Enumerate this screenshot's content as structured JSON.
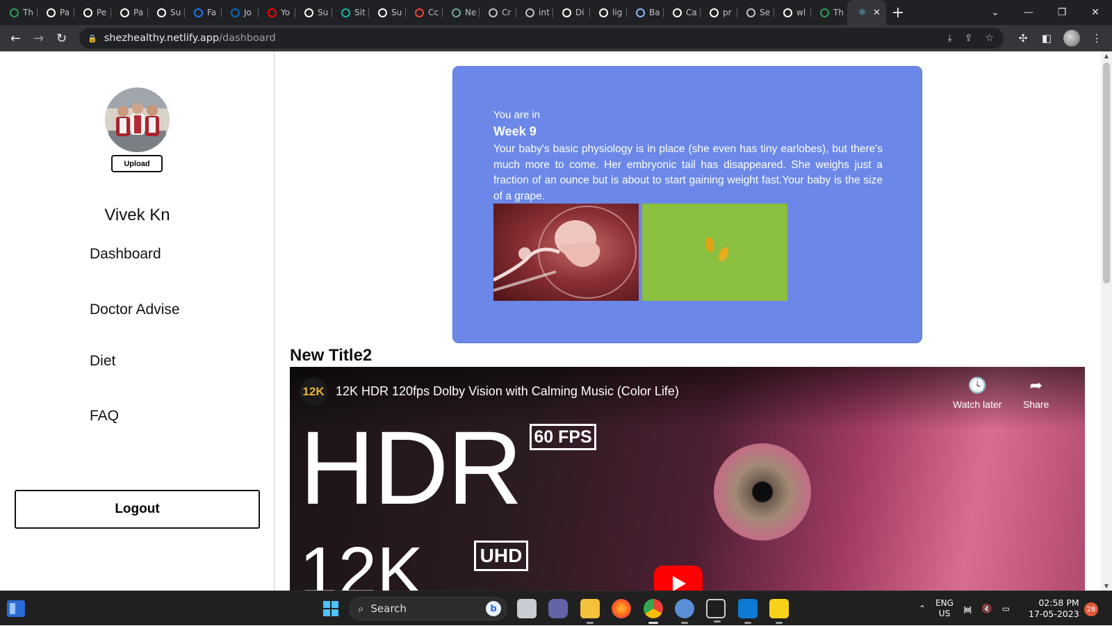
{
  "browser": {
    "tabs": [
      {
        "label": "Th",
        "icon": "wn-logo-icon",
        "color": "#2e9e5b"
      },
      {
        "label": "Pa",
        "icon": "incognito-icon",
        "color": "#ffffff"
      },
      {
        "label": "Pe",
        "icon": "incognito-icon",
        "color": "#ffffff"
      },
      {
        "label": "Pa",
        "icon": "incognito-icon",
        "color": "#ffffff"
      },
      {
        "label": "Su",
        "icon": "s-logo-icon",
        "color": "#ffffff"
      },
      {
        "label": "Fa",
        "icon": "facebook-icon",
        "color": "#1877f2"
      },
      {
        "label": "Jo",
        "icon": "linkedin-icon",
        "color": "#0a66c2"
      },
      {
        "label": "Yo",
        "icon": "youtube-icon",
        "color": "#ff0000"
      },
      {
        "label": "Su",
        "icon": "s-logo-icon",
        "color": "#ffffff"
      },
      {
        "label": "Sit",
        "icon": "diamond-icon",
        "color": "#20b2aa"
      },
      {
        "label": "Su",
        "icon": "s-logo-icon",
        "color": "#ffffff"
      },
      {
        "label": "Cc",
        "icon": "gmail-icon",
        "color": "#ea4335"
      },
      {
        "label": "Ne",
        "icon": "chatgpt-icon",
        "color": "#74aa9c"
      },
      {
        "label": "Cr",
        "icon": "square-icon",
        "color": "#bdc1c6"
      },
      {
        "label": "int",
        "icon": "square-icon",
        "color": "#bdc1c6"
      },
      {
        "label": "Di",
        "icon": "eg-icon",
        "color": "#ffffff"
      },
      {
        "label": "lig",
        "icon": "google-icon",
        "color": "#ffffff"
      },
      {
        "label": "Ba",
        "icon": "bard-icon",
        "color": "#8ab4f8"
      },
      {
        "label": "Ca",
        "icon": "google-icon",
        "color": "#ffffff"
      },
      {
        "label": "pr",
        "icon": "github-icon",
        "color": "#ffffff"
      },
      {
        "label": "Se",
        "icon": "square-icon",
        "color": "#bdc1c6"
      },
      {
        "label": "wl",
        "icon": "google-icon",
        "color": "#ffffff"
      },
      {
        "label": "Th",
        "icon": "wn-logo-icon",
        "color": "#2e9e5b"
      }
    ],
    "active_tab_icon": "react-icon",
    "close_glyph": "✕",
    "new_tab_glyph": "+",
    "url_host": "shezhealthy.netlify.app",
    "url_path": "/dashboard"
  },
  "sidebar": {
    "upload_label": "Upload",
    "user_name": "Vivek Kn",
    "nav": [
      {
        "label": "Dashboard"
      },
      {
        "label": "Doctor Advise"
      },
      {
        "label": "Diet"
      },
      {
        "label": "FAQ"
      }
    ],
    "logout_label": "Logout"
  },
  "week_card": {
    "intro": "You are in",
    "title": "Week 9",
    "description": "Your baby's basic physiology is in place (she even has tiny earlobes), but there's much more to come. Her embryonic tail has disappeared. She weighs just a fraction of an ounce but is about to start gaining weight fast.Your baby is the size of a grape."
  },
  "video_section": {
    "title": "New Title2",
    "channel_badge": "12K",
    "video_title": "12K HDR 120fps Dolby Vision with Calming Music (Color Life)",
    "watch_later": "Watch later",
    "share": "Share",
    "big_text": "HDR",
    "fps_badge": "60 FPS",
    "resolution_text": "12K",
    "uhd_badge": "UHD"
  },
  "taskbar": {
    "search_placeholder": "Search",
    "lang_line1": "ENG",
    "lang_line2": "US",
    "time": "02:58 PM",
    "date": "17-05-2023",
    "notifications": "28"
  }
}
